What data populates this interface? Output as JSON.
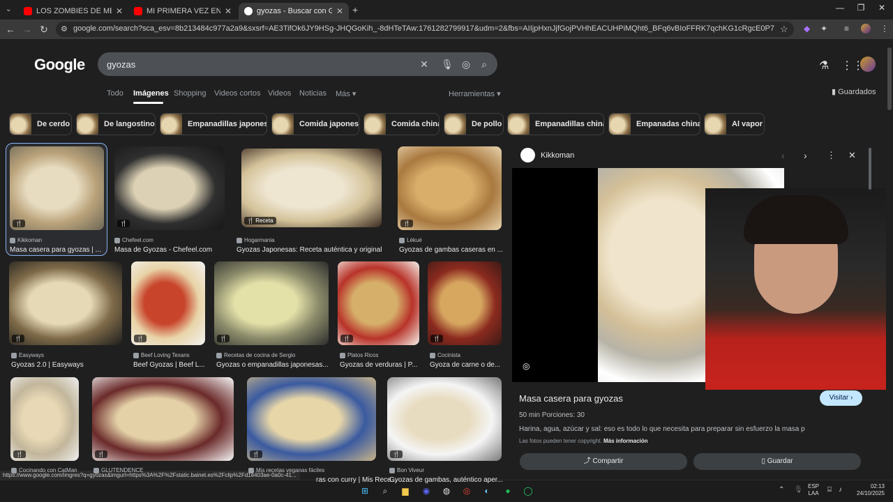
{
  "browser": {
    "tabs": [
      {
        "label": "LOS ZOMBIES DE MEDELLÍN | El",
        "icon": "youtube-icon",
        "color": "#ff0000"
      },
      {
        "label": "MI PRIMERA VEZ EN CHINA con",
        "icon": "youtube-icon",
        "color": "#ff0000"
      },
      {
        "label": "gyozas - Buscar con Google",
        "icon": "google-icon",
        "color": "#ffffff"
      }
    ],
    "new_tab": "+",
    "url": "google.com/search?sca_esv=8b213484c977a2a9&sxsrf=AE3TifOk6JY9HSg-JHQGoKih_-8dHTeTAw:1761282799917&udm=2&fbs=AIIjpHxnJjfGojPVHhEACUHPiMQht6_BFq6vBIoFFRK7qchKG1cRgcE0P7z3SNizmIu0QmIbvs5aZRIASmZWIBFvIbWP..."
  },
  "google": {
    "logo": "Google",
    "query": "gyozas",
    "nav_tabs": [
      "Todo",
      "Imágenes",
      "Shopping",
      "Videos cortos",
      "Videos",
      "Noticias",
      "Más ▾"
    ],
    "tools": "Herramientas ▾",
    "saved": "Guardados",
    "chips": [
      "De cerdo",
      "De langostinos",
      "Empanadillas japonesas",
      "Comida japonesa",
      "Comida china",
      "De pollo",
      "Empanadillas chinas",
      "Empanadas chinas",
      "Al vapor"
    ]
  },
  "results": [
    {
      "source": "Kikkoman",
      "title": "Masa casera para gyozas | ..."
    },
    {
      "source": "Chefeel.com",
      "title": "Masa de Gyozas - Chefeel.com"
    },
    {
      "source": "Hogarmania",
      "title": "Gyozas Japonesas: Receta auténtica y original",
      "badge": "Receta"
    },
    {
      "source": "Lékué",
      "title": "Gyozas de gambas caseras en ..."
    },
    {
      "source": "Easyways",
      "title": "Gyozas 2.0 | Easyways"
    },
    {
      "source": "Beef Loving Texans",
      "title": "Beef Gyozas | Beef L..."
    },
    {
      "source": "Recetas de cocina de Sergio",
      "title": "Gyozas o empanadillas japonesas..."
    },
    {
      "source": "Platos Ricos",
      "title": "Gyozas de verduras | P..."
    },
    {
      "source": "Cocinista",
      "title": "Gyoza de carne o de..."
    },
    {
      "source": "Cocinando con CatMan",
      "title": ""
    },
    {
      "source": "GLUTENDENCE",
      "title": ""
    },
    {
      "source": "Mis recetas veganas fáciles",
      "title": "ras con curry | Mis Rece..."
    },
    {
      "source": "Bon Viveur",
      "title": "Gyozas de gambas, auténtico aper..."
    }
  ],
  "panel": {
    "site": "Kikkoman",
    "title": "Masa casera para gyozas",
    "meta": "50 min    Porciones: 30",
    "desc": "Harina, agua, azúcar y sal: eso es todo lo que necesita para preparar sin esfuerzo la masa para ...",
    "copyright": "Las fotos pueden tener copyright.",
    "more_info": "Más información",
    "visit": "Visitar ›",
    "share": "Compartir",
    "save": "Guardar"
  },
  "status_url": "https://www.google.com/imgres?q=gyozas&imgurl=https%3A%2F%2Fstatic.bainet.es%2Fclip%2Fd1e403ae-0a0c-41...",
  "taskbar": {
    "lang_top": "ESP",
    "lang_bottom": "LAA",
    "time": "02:13",
    "date": "24/10/2025"
  }
}
